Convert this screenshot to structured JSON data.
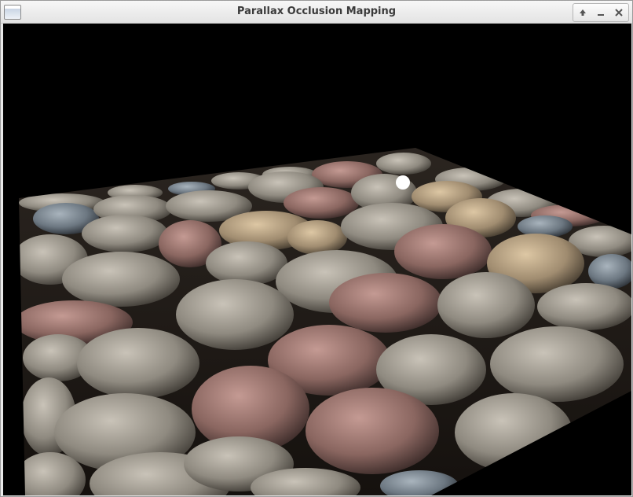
{
  "window": {
    "title": "Parallax Occlusion Mapping",
    "controls": [
      "maximize",
      "minimize",
      "close"
    ]
  },
  "scene": {
    "background_color": "#000000",
    "light_marker_color": "#ffffff"
  }
}
